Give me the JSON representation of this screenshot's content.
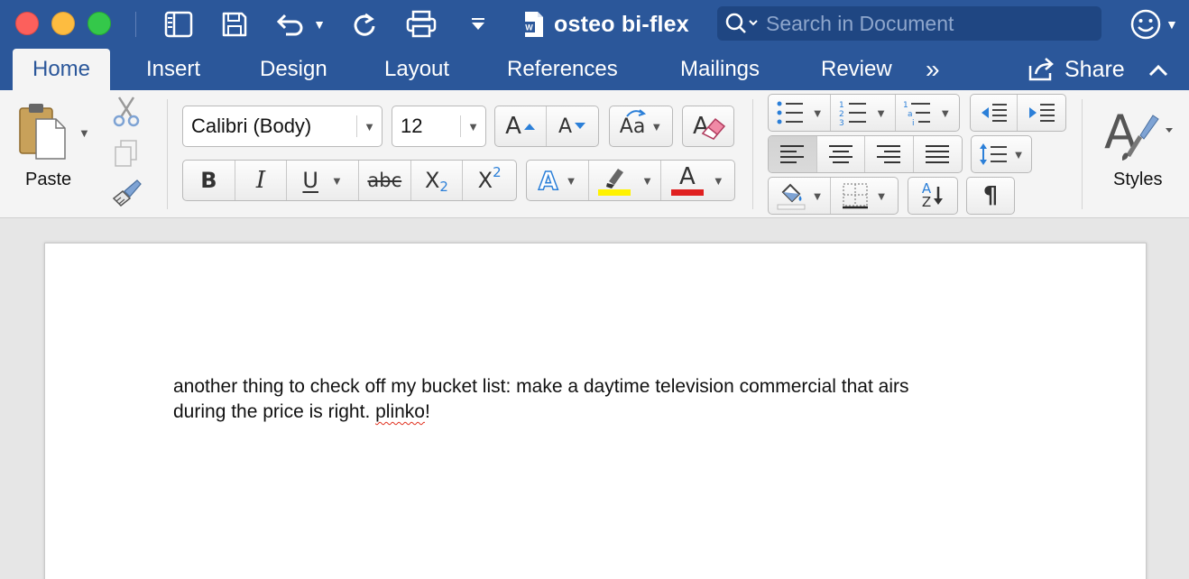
{
  "app": {
    "document_title": "osteo bi-flex",
    "search_placeholder": "Search in Document"
  },
  "tabs": [
    {
      "label": "Home",
      "active": true
    },
    {
      "label": "Insert"
    },
    {
      "label": "Design"
    },
    {
      "label": "Layout"
    },
    {
      "label": "References"
    },
    {
      "label": "Mailings"
    },
    {
      "label": "Review"
    }
  ],
  "tabs_overflow": "»",
  "share_label": "Share",
  "ribbon": {
    "paste_label": "Paste",
    "font_name": "Calibri (Body)",
    "font_size": "12",
    "bold": "B",
    "italic": "I",
    "underline": "U",
    "strikethrough": "abc",
    "subscript_base": "X",
    "subscript_mark": "2",
    "superscript_base": "X",
    "superscript_mark": "2",
    "grow_font": "A",
    "shrink_font": "A",
    "change_case": "Aa",
    "text_effects": "A",
    "font_color_letter": "A",
    "pilcrow": "¶",
    "styles_label": "Styles",
    "styles_letter": "A",
    "sort_a": "A",
    "sort_z": "Z"
  },
  "colors": {
    "brand_blue": "#2b579a",
    "highlight_yellow": "#fff200",
    "font_color_red": "#e02020"
  },
  "document": {
    "line1": "another thing to check off my bucket list: make a daytime television commercial that airs",
    "line2_prefix": "during the price is right. ",
    "misspelled": "plinko",
    "line2_suffix": "!"
  }
}
